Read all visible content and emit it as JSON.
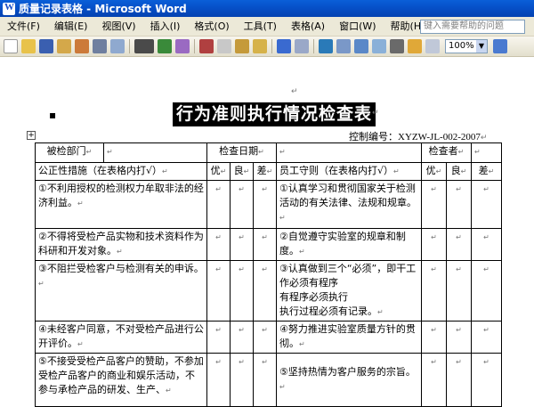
{
  "window": {
    "title": "质量记录表格 - Microsoft Word"
  },
  "menu": {
    "items": [
      "文件(F)",
      "编辑(E)",
      "视图(V)",
      "插入(I)",
      "格式(O)",
      "工具(T)",
      "表格(A)",
      "窗口(W)",
      "帮助(H)"
    ],
    "help_placeholder": "键入需要帮助的问题"
  },
  "toolbar": {
    "zoom": "100%",
    "zoom_arrow": "▼"
  },
  "document": {
    "title": "行为准则执行情况检查表",
    "bullet": "▪",
    "pilcrow": "↵",
    "handle": "+",
    "control_label": "控制编号：",
    "control_code": "XYZW-JL-002-2007",
    "header_row": {
      "dept_label": "被检部门",
      "date_label": "检查日期",
      "checker_label": "检查者"
    },
    "left_heading": "公正性措施（在表格内打√）",
    "right_heading": "员工守则（在表格内打√）",
    "grades": [
      "优",
      "良",
      "差"
    ],
    "rows": [
      {
        "left": "①不利用授权的检测权力牟取非法的经济利益。",
        "right": "①认真学习和贯彻国家关于检测活动的有关法律、法规和规章。"
      },
      {
        "left": "②不得将受检产品实物和技术资料作为科研和开发对象。",
        "right": "②自觉遵守实验室的规章和制度。"
      },
      {
        "left": "③不阻拦受检客户与检测有关的申诉。",
        "right": "③认真做到三个“必须”，即干工作必须有程序\n有程序必须执行\n执行过程必须有记录。"
      },
      {
        "left": "④未经客户同意，不对受检产品进行公开评价。",
        "right": "④努力推进实验室质量方针的贯彻。"
      },
      {
        "left": "⑤不接受受检产品客户的赞助，不参加受检产品客户的商业和娱乐活动，不参与承检产品的研发、生产、",
        "right": "⑤坚持热情为客户服务的宗旨。"
      }
    ]
  }
}
